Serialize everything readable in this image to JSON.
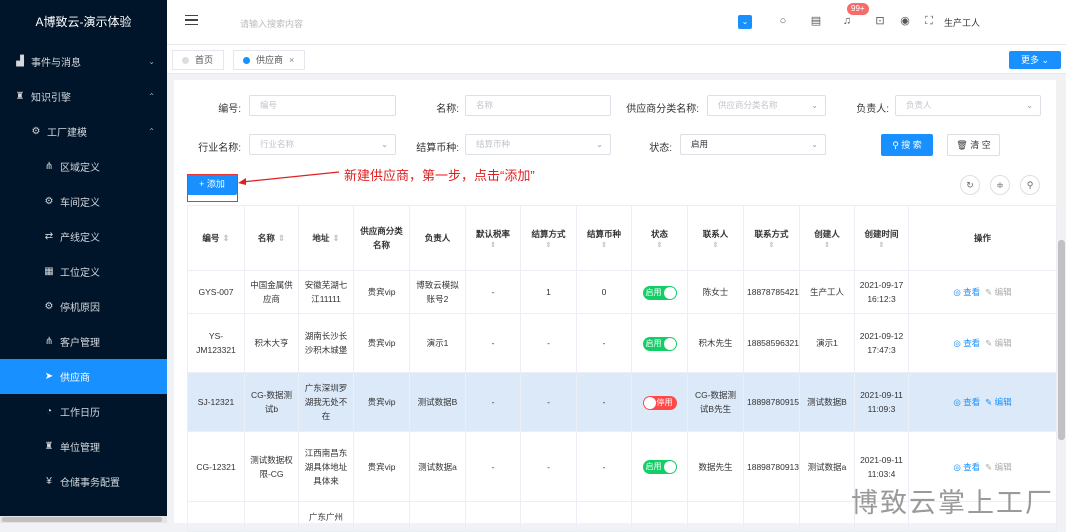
{
  "app": {
    "title": "A博致云-演示体验"
  },
  "sidebar": {
    "items": [
      {
        "label": "事件与消息",
        "icon": "chart-icon",
        "level": 1,
        "chevron": "down"
      },
      {
        "label": "知识引擎",
        "icon": "graduation-icon",
        "level": 1,
        "chevron": "up"
      },
      {
        "label": "工厂建模",
        "icon": "gear-icon",
        "level": 2,
        "chevron": "up"
      },
      {
        "label": "区域定义",
        "icon": "tree-icon",
        "level": 3
      },
      {
        "label": "车间定义",
        "icon": "gear-icon",
        "level": 3
      },
      {
        "label": "产线定义",
        "icon": "swap-icon",
        "level": 3
      },
      {
        "label": "工位定义",
        "icon": "grid-icon",
        "level": 3
      },
      {
        "label": "停机原因",
        "icon": "gear-icon",
        "level": 3
      },
      {
        "label": "客户管理",
        "icon": "tree-icon",
        "level": 3
      },
      {
        "label": "供应商",
        "icon": "send-icon",
        "level": 3,
        "active": true
      },
      {
        "label": "工作日历",
        "icon": "calendar-icon",
        "level": 3
      },
      {
        "label": "单位管理",
        "icon": "graduation-icon",
        "level": 3
      },
      {
        "label": "仓储事务配置",
        "icon": "yen-icon",
        "level": 3
      }
    ]
  },
  "topbar": {
    "search_placeholder": "请输入搜索内容",
    "badge": "99+",
    "user": "生产工人"
  },
  "tabs": [
    {
      "label": "首页",
      "active": false
    },
    {
      "label": "供应商",
      "active": true,
      "close": "×"
    }
  ],
  "more_label": "更多",
  "filters": {
    "code_label": "编号:",
    "code_placeholder": "编号",
    "name_label": "名称:",
    "name_placeholder": "名称",
    "category_label": "供应商分类名称:",
    "category_placeholder": "供应商分类名称",
    "owner_label": "负责人:",
    "owner_placeholder": "负责人",
    "industry_label": "行业名称:",
    "industry_placeholder": "行业名称",
    "currency_label": "结算币种:",
    "currency_placeholder": "结算币种",
    "status_label": "状态:",
    "status_value": "启用",
    "search_btn": "搜 索",
    "clear_btn": "清 空"
  },
  "add_btn": "+ 添加",
  "annotation": "新建供应商，第一步，点击“添加”",
  "table": {
    "headers": [
      "编号",
      "名称",
      "地址",
      "供应商分类名称",
      "负责人",
      "默认税率",
      "结算方式",
      "结算币种",
      "状态",
      "联系人",
      "联系方式",
      "创建人",
      "创建时间",
      "操作"
    ],
    "rows": [
      {
        "code": "GYS-007",
        "name": "中国金属供应商",
        "address": "安徽芜湖七江11111",
        "category": "贵宾vip",
        "owner": "博致云模拟账号2",
        "tax": "-",
        "method": "1",
        "currency": "0",
        "status": "启用",
        "status_on": true,
        "contact": "陈女士",
        "phone": "18878785421",
        "creator": "生产工人",
        "created": "2021-09-17 16:12:3",
        "view": "查看",
        "edit": "编辑"
      },
      {
        "code": "YS-JM123321",
        "name": "积木大亨",
        "address": "湖南长沙长沙积木城堡",
        "category": "贵宾vip",
        "owner": "演示1",
        "tax": "-",
        "method": "-",
        "currency": "-",
        "status": "启用",
        "status_on": true,
        "contact": "积木先生",
        "phone": "18858596321",
        "creator": "演示1",
        "created": "2021-09-12 17:47:3",
        "view": "查看",
        "edit": "编辑"
      },
      {
        "code": "SJ-12321",
        "name": "CG-数据测试b",
        "address": "广东深圳罗湖我无处不在",
        "category": "贵宾vip",
        "owner": "测试数据B",
        "tax": "-",
        "method": "-",
        "currency": "-",
        "status": "停用",
        "status_on": false,
        "contact": "CG-数据测试B先生",
        "phone": "18898780915",
        "creator": "测试数据B",
        "created": "2021-09-11 11:09:3",
        "view": "查看",
        "edit": "编辑"
      },
      {
        "code": "CG-12321",
        "name": "测试数据权限-CG",
        "address": "江西南昌东湖具体地址具体来",
        "category": "贵宾vip",
        "owner": "测试数据a",
        "tax": "-",
        "method": "-",
        "currency": "-",
        "status": "启用",
        "status_on": true,
        "contact": "数据先生",
        "phone": "18898780913",
        "creator": "测试数据a",
        "created": "2021-09-11 11:03:4",
        "view": "查看",
        "edit": "编辑"
      },
      {
        "code": "",
        "name": "",
        "address": "广东广州",
        "category": "",
        "owner": "",
        "tax": "",
        "method": "",
        "currency": "",
        "status": "",
        "contact": "",
        "phone": "",
        "creator": "",
        "created": "",
        "view": "",
        "edit": ""
      }
    ]
  },
  "watermark": "博致云掌上工厂"
}
